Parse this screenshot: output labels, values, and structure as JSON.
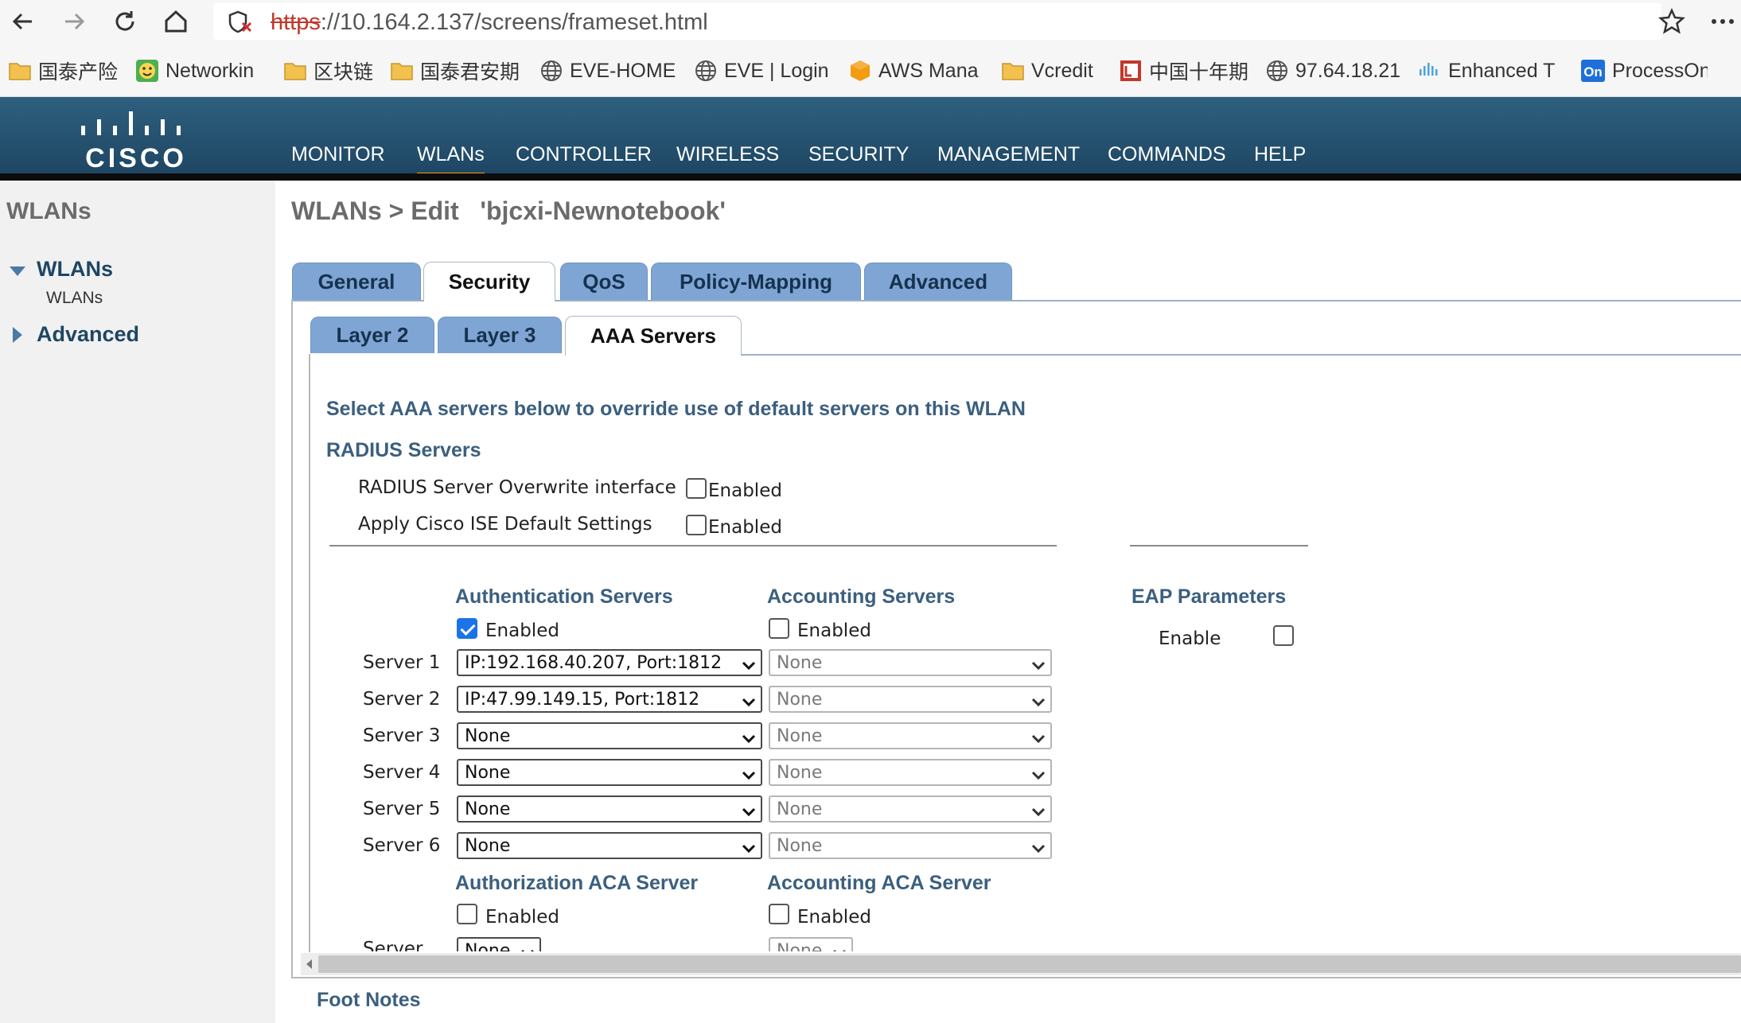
{
  "browser": {
    "url_scheme": "https",
    "url_rest": "://10.164.2.137/screens/frameset.html",
    "bookmarks": [
      {
        "label": "国泰产险",
        "icon": "folder-icon"
      },
      {
        "label": "Networkin",
        "icon": "smiley-icon"
      },
      {
        "label": "区块链",
        "icon": "folder-icon"
      },
      {
        "label": "国泰君安期",
        "icon": "folder-icon"
      },
      {
        "label": "EVE-HOME",
        "icon": "globe-icon"
      },
      {
        "label": "EVE | Login",
        "icon": "globe-icon"
      },
      {
        "label": "AWS Mana",
        "icon": "cube-icon"
      },
      {
        "label": "Vcredit",
        "icon": "folder-icon"
      },
      {
        "label": "中国十年期",
        "icon": "le-icon"
      },
      {
        "label": "97.64.18.21",
        "icon": "globe-icon"
      },
      {
        "label": "Enhanced T",
        "icon": "cisco-icon"
      },
      {
        "label": "ProcessOn",
        "icon": "on-icon"
      }
    ]
  },
  "header": {
    "logo_text": "CISCO",
    "menu": [
      "MONITOR",
      "WLANs",
      "CONTROLLER",
      "WIRELESS",
      "SECURITY",
      "MANAGEMENT",
      "COMMANDS",
      "HELP"
    ],
    "active_menu": "WLANs"
  },
  "sidebar": {
    "title": "WLANs",
    "group_label": "WLANs",
    "sub_item": "WLANs",
    "advanced_label": "Advanced"
  },
  "page": {
    "title": "WLANs > Edit   'bjcxi-Newnotebook'",
    "tabs": [
      "General",
      "Security",
      "QoS",
      "Policy-Mapping",
      "Advanced"
    ],
    "active_tab": "Security",
    "subtabs": [
      "Layer 2",
      "Layer 3",
      "AAA Servers"
    ],
    "active_subtab": "AAA Servers",
    "intro": "Select AAA servers below to override use of default servers on this WLAN",
    "radius_heading": "RADIUS Servers",
    "overwrite_label": "RADIUS Server Overwrite interface",
    "overwrite_enabled": false,
    "ise_label": "Apply Cisco ISE Default Settings",
    "ise_enabled": false,
    "enabled_text": "Enabled",
    "auth_heading": "Authentication Servers",
    "auth_enabled": true,
    "acct_heading": "Accounting Servers",
    "acct_enabled": false,
    "eap_heading": "EAP Parameters",
    "eap_enable_label": "Enable",
    "eap_enabled": false,
    "servers": [
      {
        "label": "Server 1",
        "auth": "IP:192.168.40.207, Port:1812",
        "acct": "None"
      },
      {
        "label": "Server 2",
        "auth": "IP:47.99.149.15, Port:1812",
        "acct": "None"
      },
      {
        "label": "Server 3",
        "auth": "None",
        "acct": "None"
      },
      {
        "label": "Server 4",
        "auth": "None",
        "acct": "None"
      },
      {
        "label": "Server 5",
        "auth": "None",
        "acct": "None"
      },
      {
        "label": "Server 6",
        "auth": "None",
        "acct": "None"
      }
    ],
    "authz_aca_heading": "Authorization ACA Server",
    "acct_aca_heading": "Accounting ACA Server",
    "authz_aca_enabled": false,
    "acct_aca_enabled": false,
    "aca_server_label": "Server",
    "aca_authz_value": "None",
    "aca_acct_value": "None",
    "foot_notes": "Foot Notes"
  }
}
